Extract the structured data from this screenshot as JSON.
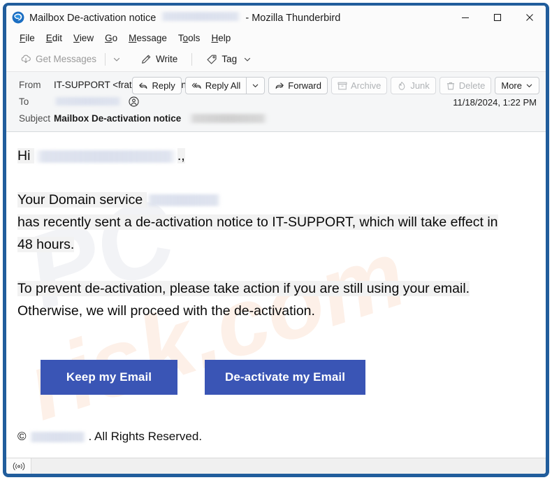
{
  "window": {
    "title_prefix": "Mailbox De-activation notice",
    "title_redacted": true,
    "title_suffix": "- Mozilla Thunderbird",
    "app_icon": "thunderbird-icon",
    "controls": {
      "minimize": "minimize-icon",
      "maximize": "maximize-icon",
      "close": "close-icon"
    }
  },
  "menu": {
    "items": [
      {
        "label": "File",
        "accesskey": "F"
      },
      {
        "label": "Edit",
        "accesskey": "E"
      },
      {
        "label": "View",
        "accesskey": "V"
      },
      {
        "label": "Go",
        "accesskey": "G"
      },
      {
        "label": "Message",
        "accesskey": "M"
      },
      {
        "label": "Tools",
        "accesskey": "T"
      },
      {
        "label": "Help",
        "accesskey": "H"
      }
    ]
  },
  "toolbar": {
    "get_messages": "Get Messages",
    "get_messages_icon": "download-cloud-icon",
    "get_messages_caret": "chevron-down-icon",
    "write": "Write",
    "write_icon": "pencil-icon",
    "tag": "Tag",
    "tag_icon": "tag-icon",
    "tag_caret": "chevron-down-icon"
  },
  "message_header": {
    "from_label": "From",
    "from_value": "IT-SUPPORT <fratelli089@aqintesy.org>",
    "from_contact_icon": "contact-card-icon",
    "to_label": "To",
    "to_value_redacted": true,
    "to_contact_icon": "contact-card-icon",
    "subject_label": "Subject",
    "subject_value": "Mailbox De-activation notice",
    "subject_redacted": true,
    "date": "11/18/2024, 1:22 PM",
    "actions": [
      {
        "label": "Reply",
        "icon": "reply-icon",
        "disabled": false
      },
      {
        "label": "Reply All",
        "icon": "reply-all-icon",
        "disabled": false,
        "caret": "chevron-down-icon"
      },
      {
        "label": "Forward",
        "icon": "forward-icon",
        "disabled": false
      },
      {
        "label": "Archive",
        "icon": "archive-box-icon",
        "disabled": true
      },
      {
        "label": "Junk",
        "icon": "junk-flame-icon",
        "disabled": true
      },
      {
        "label": "Delete",
        "icon": "trash-icon",
        "disabled": true
      },
      {
        "label": "More",
        "icon": "chevron-down-icon",
        "disabled": false
      }
    ]
  },
  "body": {
    "greeting_prefix": "Hi",
    "greeting_name_redacted": true,
    "greeting_suffix": ".,",
    "para1_lead": "Your Domain service",
    "para1_domain_redacted": true,
    "para1_rest_line1": "has recently sent a de-activation notice to IT-SUPPORT, which will take effect in",
    "para1_rest_line2": "48 hours.",
    "para2_line1": "To prevent de-activation, please take action if you are still using your email.",
    "para2_line2": "Otherwise, we will proceed with the de-activation.",
    "cta_keep": "Keep my Email",
    "cta_deactivate": "De-activate my Email",
    "footer_copyright_symbol": "©",
    "footer_company_redacted": true,
    "footer_rest": ". All Rights Reserved.",
    "watermark_text": "pcrisk.com"
  },
  "status_bar": {
    "icon": "broadcast-antenna-icon",
    "text": ""
  },
  "colors": {
    "window_border": "#215d9c",
    "cta_button": "#3a55b5",
    "cta_text": "#ffffff",
    "header_background": "#f5f6f7",
    "chrome_background": "#fbfbfb",
    "text_highlight": "#f2f2f2"
  }
}
